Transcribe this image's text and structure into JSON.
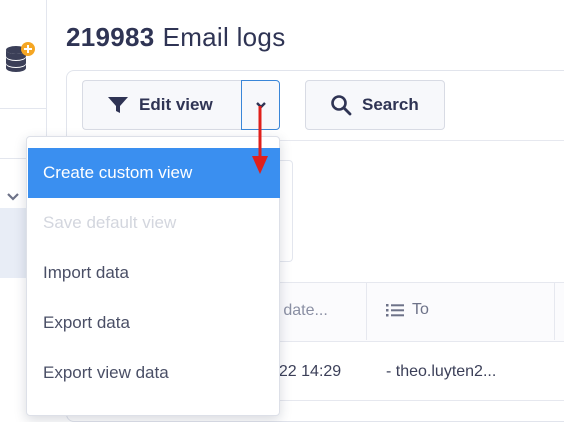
{
  "page": {
    "record_id": "219983",
    "title": "Email logs"
  },
  "toolbar": {
    "edit_view_label": "Edit view",
    "search_label": "Search"
  },
  "view_menu": {
    "items": [
      {
        "label": "Create custom view",
        "state": "highlighted"
      },
      {
        "label": "Save default view",
        "state": "disabled"
      },
      {
        "label": "Import data",
        "state": "normal"
      },
      {
        "label": "Export data",
        "state": "normal"
      },
      {
        "label": "Export view data",
        "state": "normal"
      }
    ]
  },
  "table": {
    "columns": [
      {
        "label": "e date..."
      },
      {
        "label": "To",
        "icon": "list-icon"
      }
    ],
    "rows": [
      {
        "date": "022 14:29",
        "to": "- theo.luyten2..."
      }
    ]
  },
  "colors": {
    "highlight": "#3a8ff0",
    "caret_border": "#3a86d8",
    "annotation_arrow": "#e0201b",
    "badge": "#f5a623"
  }
}
